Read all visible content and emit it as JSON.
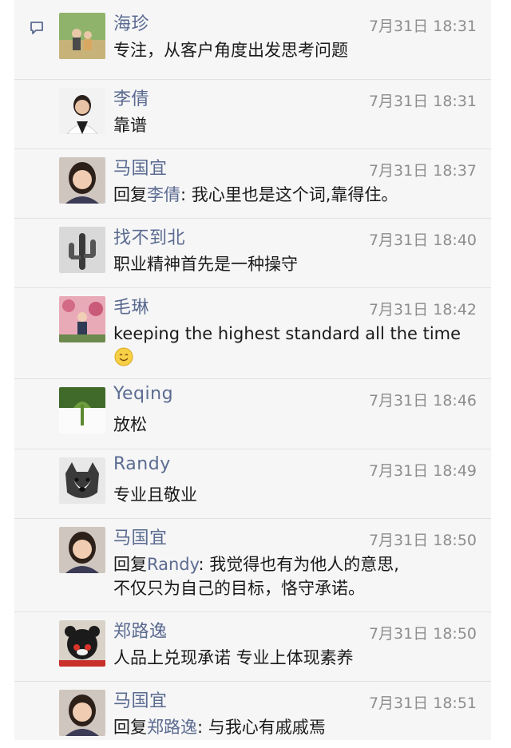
{
  "comments": [
    {
      "name": "海珍",
      "time": "7月31日 18:31",
      "text": "专注，从客户角度出发思考问题",
      "avatar_icon": "avatar-couple-park"
    },
    {
      "name": "李倩",
      "time": "7月31日 18:31",
      "text": "靠谱",
      "avatar_icon": "avatar-woman-portrait"
    },
    {
      "name": "马国宜",
      "time": "7月31日 18:37",
      "reply_prefix": "回复",
      "reply_to": "李倩",
      "text": ": 我心里也是这个词,靠得住。",
      "avatar_icon": "avatar-woman-smiling"
    },
    {
      "name": "找不到北",
      "time": "7月31日 18:40",
      "text": "职业精神首先是一种操守",
      "avatar_icon": "avatar-cactus-bw"
    },
    {
      "name": "毛琳",
      "time": "7月31日 18:42",
      "text": "keeping the highest standard all the time",
      "emoji": "smile-emoji",
      "avatar_icon": "avatar-woman-flowers"
    },
    {
      "name": "Yeqing",
      "time": "7月31日 18:46",
      "text": "放松",
      "avatar_icon": "avatar-plant"
    },
    {
      "name": "Randy",
      "time": "7月31日 18:49",
      "text": "专业且敬业",
      "avatar_icon": "avatar-dog"
    },
    {
      "name": "马国宜",
      "time": "7月31日 18:50",
      "reply_prefix": "回复",
      "reply_to": "Randy",
      "text": ": 我觉得也有为他人的意思,",
      "text2": "不仅只为自己的目标，恪守承诺。",
      "avatar_icon": "avatar-woman-smiling"
    },
    {
      "name": "郑路逸",
      "time": "7月31日 18:50",
      "text": "人品上兑现承诺 专业上体现素养",
      "avatar_icon": "avatar-kumamon"
    },
    {
      "name": "马国宜",
      "time": "7月31日 18:51",
      "reply_prefix": "回复",
      "reply_to": "郑路逸",
      "text": ": 与我心有戚戚焉",
      "avatar_icon": "avatar-woman-smiling"
    }
  ],
  "colors": {
    "name": "#5b6b90",
    "time": "#8d8d8d",
    "text": "#1a1a1a",
    "background": "#f6f6f7"
  }
}
